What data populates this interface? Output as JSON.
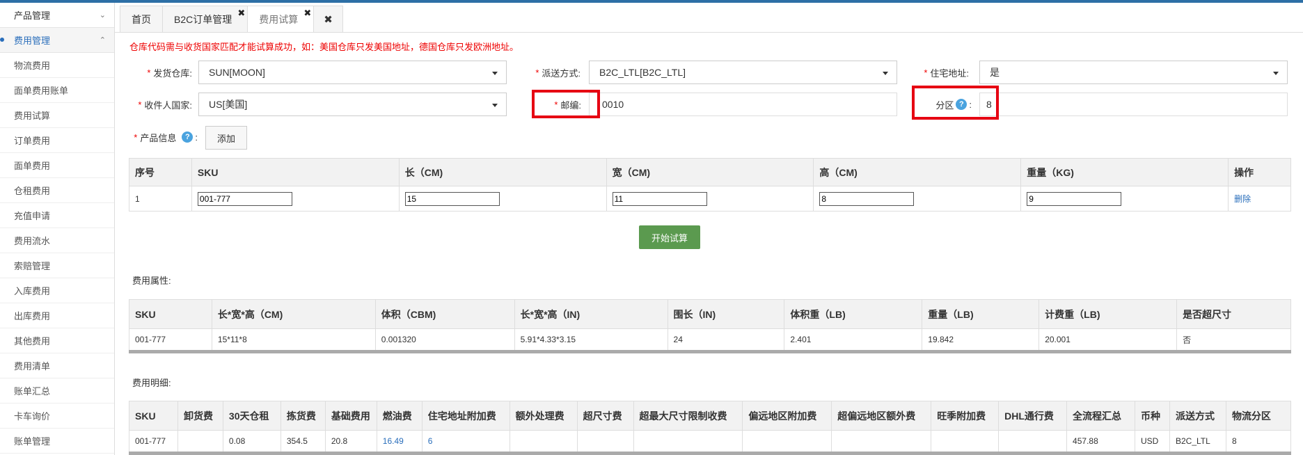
{
  "sidebar": {
    "groups": [
      {
        "label": "产品管理",
        "chevron": "chevron-down-icon"
      },
      {
        "label": "费用管理",
        "chevron": "chevron-up-icon"
      }
    ],
    "items": [
      "物流费用",
      "面单费用账单",
      "费用试算",
      "订单费用",
      "面单费用",
      "仓租费用",
      "充值申请",
      "费用流水",
      "索赔管理",
      "入库费用",
      "出库费用",
      "其他费用",
      "费用清单",
      "账单汇总",
      "卡车询价",
      "账单管理"
    ]
  },
  "tabs": [
    {
      "label": "首页"
    },
    {
      "label": "B2C订单管理"
    },
    {
      "label": "费用试算"
    }
  ],
  "close_glyph": "✖",
  "notice": "仓库代码需与收货国家匹配才能试算成功，如：美国仓库只发美国地址，德国仓库只发欧洲地址。",
  "form": {
    "warehouse_label": "发货仓库:",
    "warehouse_value": "SUN[MOON]",
    "delivery_label": "派送方式:",
    "delivery_value": "B2C_LTL[B2C_LTL]",
    "residential_label": "住宅地址:",
    "residential_value": "是",
    "country_label": "收件人国家:",
    "country_value": "US[美国]",
    "zip_label": "邮编:",
    "zip_value": "0010",
    "zone_label": "分区",
    "zone_value": "8",
    "product_label": "产品信息",
    "add_label": "添加",
    "required_mark": "*",
    "colon": ":"
  },
  "product_table": {
    "headers": [
      "序号",
      "SKU",
      "长（CM)",
      "宽（CM)",
      "高（CM)",
      "重量（KG)",
      "操作"
    ],
    "row": {
      "index": "1",
      "sku": "001-777",
      "length": "15",
      "width": "11",
      "height": "8",
      "weight": "9",
      "action": "删除"
    }
  },
  "calc_button": "开始试算",
  "attr_section": {
    "title": "费用属性:",
    "headers": [
      "SKU",
      "长*宽*高（CM)",
      "体积（CBM)",
      "长*宽*高（IN)",
      "围长（IN)",
      "体积重（LB)",
      "重量（LB)",
      "计费重（LB)",
      "是否超尺寸"
    ],
    "row": [
      "001-777",
      "15*11*8",
      "0.001320",
      "5.91*4.33*3.15",
      "24",
      "2.401",
      "19.842",
      "20.001",
      "否"
    ]
  },
  "detail_section": {
    "title": "费用明细:",
    "headers": [
      "SKU",
      "卸货费",
      "30天仓租",
      "拣货费",
      "基础费用",
      "燃油费",
      "住宅地址附加费",
      "额外处理费",
      "超尺寸费",
      "超最大尺寸限制收费",
      "偏远地区附加费",
      "超偏远地区额外费",
      "旺季附加费",
      "DHL通行费",
      "全流程汇总",
      "币种",
      "派送方式",
      "物流分区"
    ],
    "row": [
      "001-777",
      "",
      "0.08",
      "354.5",
      "20.8",
      "16.49",
      "6",
      "",
      "",
      "",
      "",
      "",
      "",
      "",
      "457.88",
      "USD",
      "B2C_LTL",
      "8"
    ]
  },
  "colors": {
    "accent": "#2a6ebb",
    "required": "#e00000",
    "highlight_box": "#e60012",
    "calc_button": "#5b9a4f"
  }
}
